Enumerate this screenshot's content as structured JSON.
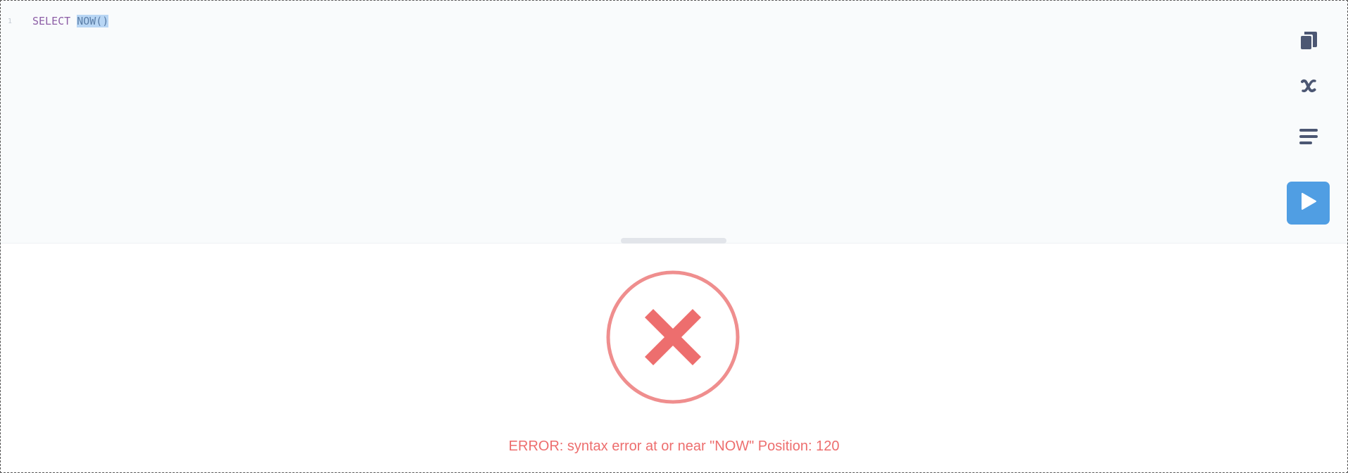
{
  "editor": {
    "line_number": "1",
    "keyword": "SELECT",
    "function_call": "NOW()"
  },
  "toolbar": {
    "items": [
      {
        "name": "data-reference-icon"
      },
      {
        "name": "variables-icon"
      },
      {
        "name": "snippets-icon"
      }
    ],
    "run_icon": "play-icon"
  },
  "result": {
    "error_icon": "error-x-icon",
    "error_message": "ERROR: syntax error at or near \"NOW\" Position: 120"
  },
  "colors": {
    "accent": "#509ee3",
    "error": "#ed6e6e",
    "icon": "#4c5773",
    "keyword": "#8d5ea6",
    "selection": "#b8d6f4"
  }
}
